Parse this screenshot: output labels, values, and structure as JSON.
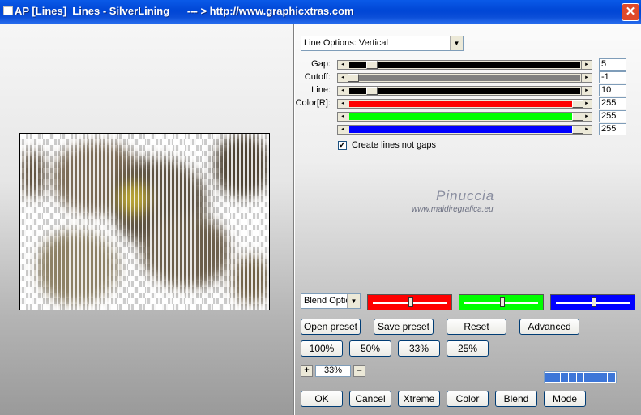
{
  "window": {
    "title": "AP [Lines]  Lines - SilverLining      --- > http://www.graphicxtras.com",
    "close_icon": "close-icon"
  },
  "options": {
    "line_options": "Line Options: Vertical"
  },
  "sliders": [
    {
      "label": "Gap:",
      "value": "5",
      "color": "#000000",
      "level": 0.04
    },
    {
      "label": "Cutoff:",
      "value": "-1",
      "color": "#808080",
      "level": 0.0
    },
    {
      "label": "Line:",
      "value": "10",
      "color": "#000000",
      "level": 0.04
    },
    {
      "label": "Color[R]:",
      "value": "255",
      "color": "#ff0000",
      "level": 1.0
    },
    {
      "label": "",
      "value": "255",
      "color": "#00ff00",
      "level": 1.0
    },
    {
      "label": "",
      "value": "255",
      "color": "#0000ff",
      "level": 1.0
    }
  ],
  "checkbox": {
    "label": "Create lines not gaps",
    "checked": true
  },
  "watermark": {
    "name": "Pinuccia",
    "url": "www.maidiregrafica.eu"
  },
  "blend": {
    "select": "Blend Optio",
    "channels": [
      {
        "color": "#ff0000",
        "level": 0.5
      },
      {
        "color": "#00ff00",
        "level": 0.5
      },
      {
        "color": "#0000ff",
        "level": 0.5
      }
    ]
  },
  "buttons": {
    "open_preset": "Open preset",
    "save_preset": "Save preset",
    "reset": "Reset",
    "advanced": "Advanced",
    "z100": "100%",
    "z50": "50%",
    "z33": "33%",
    "z25": "25%",
    "ok": "OK",
    "cancel": "Cancel",
    "xtreme": "Xtreme",
    "color": "Color",
    "blend": "Blend",
    "mode": "Mode"
  },
  "zoom": {
    "plus": "+",
    "value": "33%",
    "minus": "–"
  },
  "progress": {
    "segments": 9
  }
}
